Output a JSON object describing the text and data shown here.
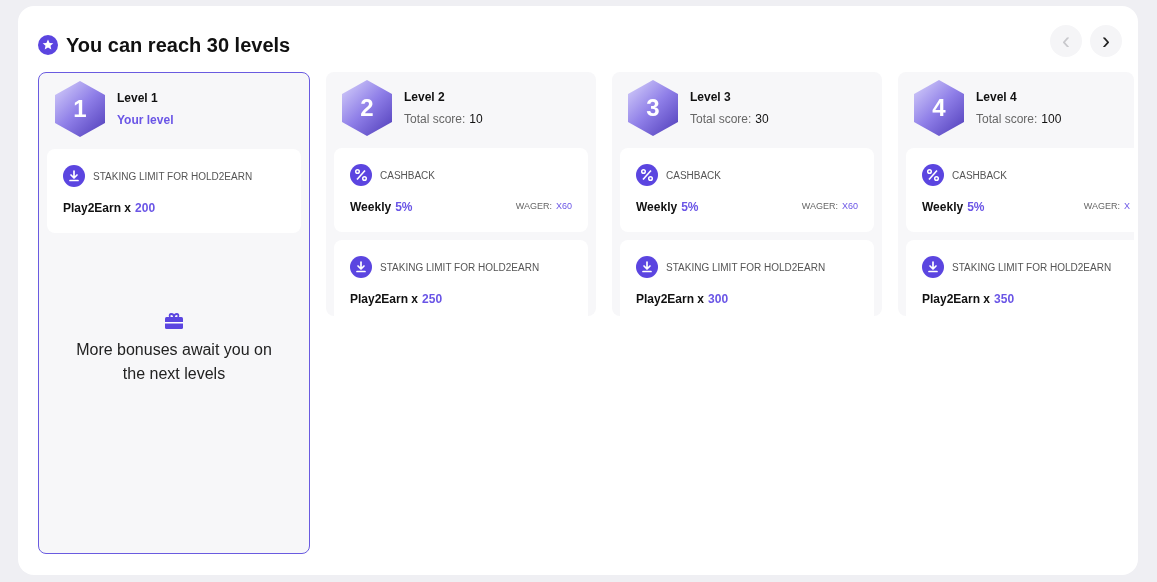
{
  "header": {
    "title": "You can reach 30 levels"
  },
  "nav": [
    {
      "label": "‹",
      "disabled": true
    },
    {
      "label": "›",
      "disabled": false
    }
  ],
  "levels": [
    {
      "number": "1",
      "title": "Level 1",
      "selected": true,
      "subtitle": "Your level",
      "perks": [
        {
          "kind": "staking",
          "label": "STAKING LIMIT FOR HOLD2EARN",
          "name": "Play2Earn x",
          "value": "200"
        }
      ],
      "more": "More bonuses await you on the next levels"
    },
    {
      "number": "2",
      "title": "Level 2",
      "selected": false,
      "score_label": "Total score:",
      "score": "10",
      "perks": [
        {
          "kind": "cashback",
          "label": "CASHBACK",
          "name": "Weekly",
          "value": "5%",
          "wager_label": "WAGER:",
          "wager": "X60"
        },
        {
          "kind": "staking",
          "label": "STAKING LIMIT FOR HOLD2EARN",
          "name": "Play2Earn x",
          "value": "250"
        }
      ]
    },
    {
      "number": "3",
      "title": "Level 3",
      "selected": false,
      "score_label": "Total score:",
      "score": "30",
      "perks": [
        {
          "kind": "cashback",
          "label": "CASHBACK",
          "name": "Weekly",
          "value": "5%",
          "wager_label": "WAGER:",
          "wager": "X60"
        },
        {
          "kind": "staking",
          "label": "STAKING LIMIT FOR HOLD2EARN",
          "name": "Play2Earn x",
          "value": "300"
        }
      ]
    },
    {
      "number": "4",
      "title": "Level 4",
      "selected": false,
      "score_label": "Total score:",
      "score": "100",
      "perks": [
        {
          "kind": "cashback",
          "label": "CASHBACK",
          "name": "Weekly",
          "value": "5%",
          "wager_label": "WAGER:",
          "wager": "X"
        },
        {
          "kind": "staking",
          "label": "STAKING LIMIT FOR HOLD2EARN",
          "name": "Play2Earn x",
          "value": "350"
        }
      ]
    }
  ]
}
